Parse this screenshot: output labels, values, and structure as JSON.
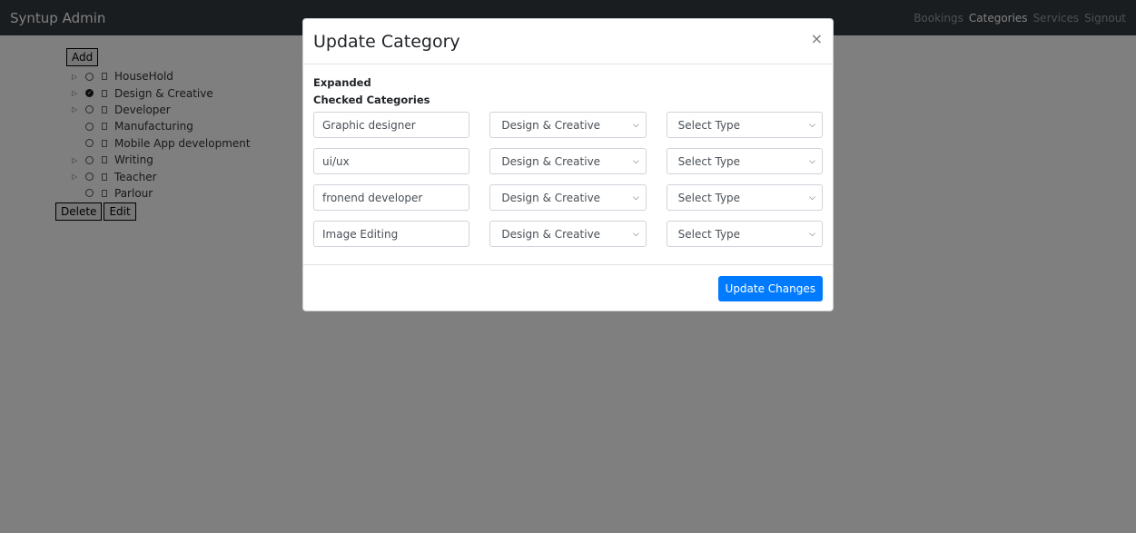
{
  "navbar": {
    "brand": "Syntup Admin",
    "links": [
      "Bookings",
      "Categories",
      "Services",
      "Signout"
    ]
  },
  "tree": {
    "add_label": "Add",
    "items": [
      {
        "label": "HouseHold",
        "expandable": true,
        "checked": false
      },
      {
        "label": "Design & Creative",
        "expandable": true,
        "checked": true
      },
      {
        "label": "Developer",
        "expandable": true,
        "checked": false
      },
      {
        "label": "Manufacturing",
        "expandable": false,
        "checked": false
      },
      {
        "label": "Mobile App development",
        "expandable": false,
        "checked": false
      },
      {
        "label": "Writing",
        "expandable": true,
        "checked": false
      },
      {
        "label": "Teacher",
        "expandable": true,
        "checked": false
      },
      {
        "label": "Parlour",
        "expandable": false,
        "checked": false
      }
    ],
    "delete_label": "Delete",
    "edit_label": "Edit"
  },
  "modal": {
    "title": "Update Category",
    "close_symbol": "×",
    "expanded_label": "Expanded",
    "checked_label": "Checked Categories",
    "rows": [
      {
        "name": "Graphic designer",
        "category": "Design & Creative",
        "type": "Select Type"
      },
      {
        "name": "ui/ux",
        "category": "Design & Creative",
        "type": "Select Type"
      },
      {
        "name": "fronend developer",
        "category": "Design & Creative",
        "type": "Select Type"
      },
      {
        "name": "Image Editing",
        "category": "Design & Creative",
        "type": "Select Type"
      }
    ],
    "submit_label": "Update Changes"
  },
  "colors": {
    "navbar_bg": "#343a40",
    "primary": "#007bff"
  }
}
